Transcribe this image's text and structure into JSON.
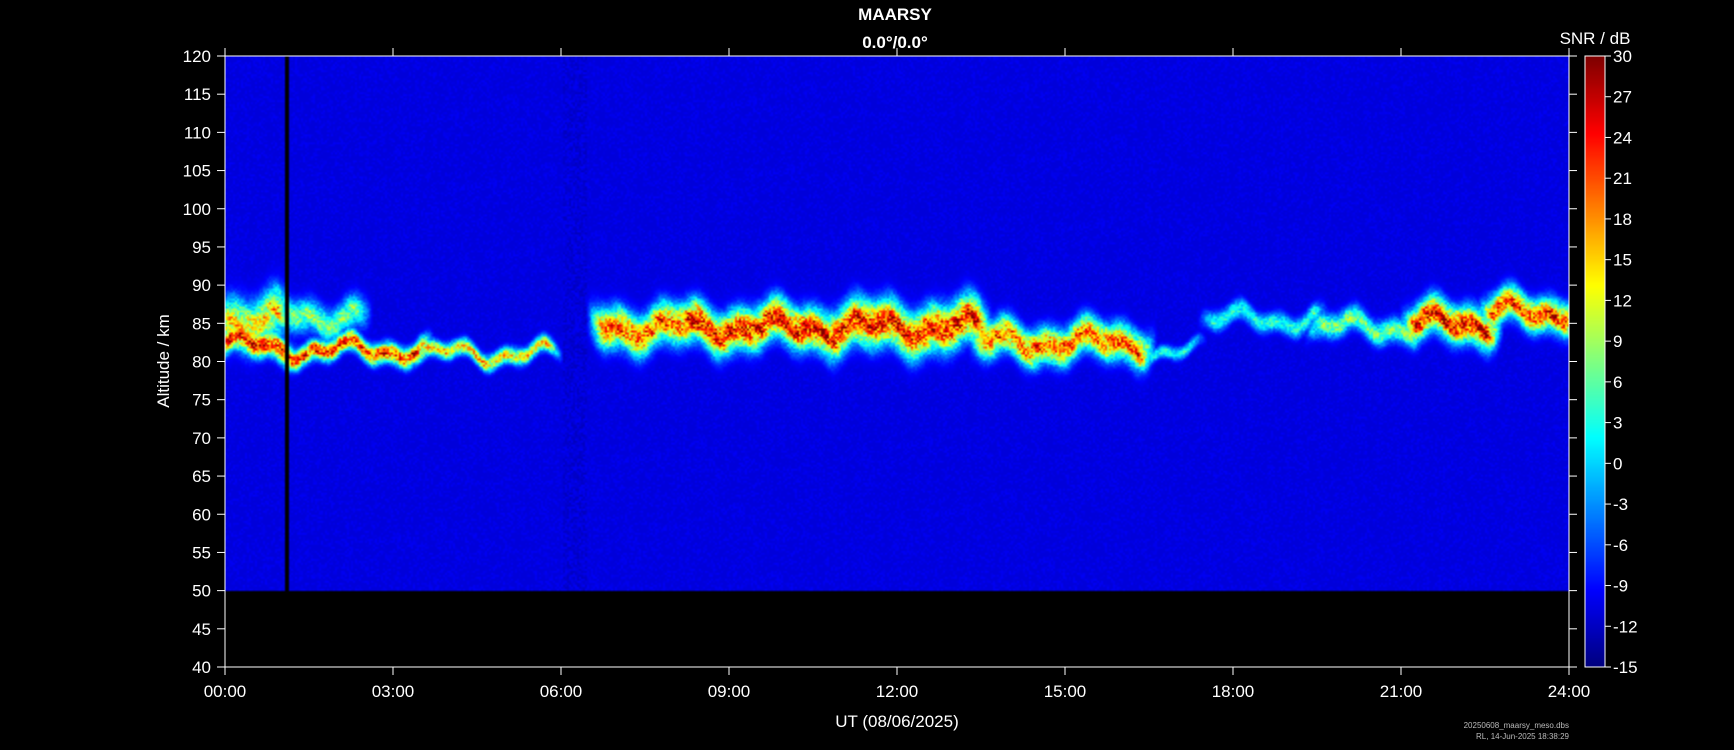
{
  "chart_data": {
    "type": "heatmap",
    "title": "MAARSY",
    "subtitle": "0.0°/0.0°",
    "xlabel": "UT (08/06/2025)",
    "ylabel": "Altitude / km",
    "colorbar_label": "SNR / dB",
    "xlim": [
      0,
      24
    ],
    "ylim": [
      40,
      120
    ],
    "clim": [
      -15,
      30
    ],
    "x_ticks": [
      0,
      3,
      6,
      9,
      12,
      15,
      18,
      21,
      24
    ],
    "x_tick_labels": [
      "00:00",
      "03:00",
      "06:00",
      "09:00",
      "12:00",
      "15:00",
      "18:00",
      "21:00",
      "24:00"
    ],
    "y_ticks": [
      40,
      45,
      50,
      55,
      60,
      65,
      70,
      75,
      80,
      85,
      90,
      95,
      100,
      105,
      110,
      115,
      120
    ],
    "c_ticks": [
      30,
      27,
      24,
      21,
      18,
      15,
      12,
      9,
      6,
      3,
      0,
      -3,
      -6,
      -9,
      -12,
      -15
    ],
    "colormap": "jet",
    "background_snr": -11,
    "data_altitude_range": [
      50,
      120
    ],
    "data_gap_hours": [
      1.08,
      1.14
    ],
    "echo_layers": [
      {
        "t_start": 0.0,
        "t_end": 1.0,
        "alt_center": 85.5,
        "alt_half_width": 3.0,
        "peak_snr": 18
      },
      {
        "t_start": 0.0,
        "t_end": 1.1,
        "alt_center": 82.0,
        "alt_half_width": 1.5,
        "peak_snr": 29
      },
      {
        "t_start": 1.1,
        "t_end": 2.4,
        "alt_center": 86.0,
        "alt_half_width": 2.0,
        "peak_snr": 10
      },
      {
        "t_start": 1.1,
        "t_end": 3.5,
        "alt_center": 81.5,
        "alt_half_width": 1.2,
        "peak_snr": 27
      },
      {
        "t_start": 3.5,
        "t_end": 5.8,
        "alt_center": 81.0,
        "alt_half_width": 1.0,
        "peak_snr": 18
      },
      {
        "t_start": 6.7,
        "t_end": 8.2,
        "alt_center": 84.5,
        "alt_half_width": 2.5,
        "peak_snr": 24
      },
      {
        "t_start": 8.2,
        "t_end": 10.8,
        "alt_center": 84.5,
        "alt_half_width": 2.5,
        "peak_snr": 29
      },
      {
        "t_start": 10.8,
        "t_end": 13.5,
        "alt_center": 84.5,
        "alt_half_width": 2.8,
        "peak_snr": 28
      },
      {
        "t_start": 13.5,
        "t_end": 16.4,
        "alt_center": 82.5,
        "alt_half_width": 2.2,
        "peak_snr": 24
      },
      {
        "t_start": 16.4,
        "t_end": 17.3,
        "alt_center": 81.5,
        "alt_half_width": 0.8,
        "peak_snr": 5
      },
      {
        "t_start": 17.6,
        "t_end": 19.5,
        "alt_center": 85.5,
        "alt_half_width": 1.2,
        "peak_snr": 6
      },
      {
        "t_start": 19.5,
        "t_end": 21.2,
        "alt_center": 84.5,
        "alt_half_width": 1.5,
        "peak_snr": 10
      },
      {
        "t_start": 21.2,
        "t_end": 22.6,
        "alt_center": 85.0,
        "alt_half_width": 2.2,
        "peak_snr": 29
      },
      {
        "t_start": 22.6,
        "t_end": 24.0,
        "alt_center": 86.5,
        "alt_half_width": 2.0,
        "peak_snr": 26
      }
    ]
  },
  "footer": {
    "file_name": "20250608_maarsy_meso.dbs",
    "author_timestamp": "RL, 14-Jun-2025 18:38:29"
  }
}
